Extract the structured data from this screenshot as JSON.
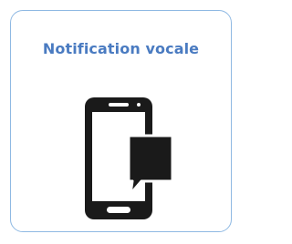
{
  "card": {
    "title": "Notification vocale",
    "icon": "phone-message-icon"
  },
  "colors": {
    "title": "#4a7bc1",
    "border": "#8fb9e3",
    "icon": "#1a1a1a"
  }
}
